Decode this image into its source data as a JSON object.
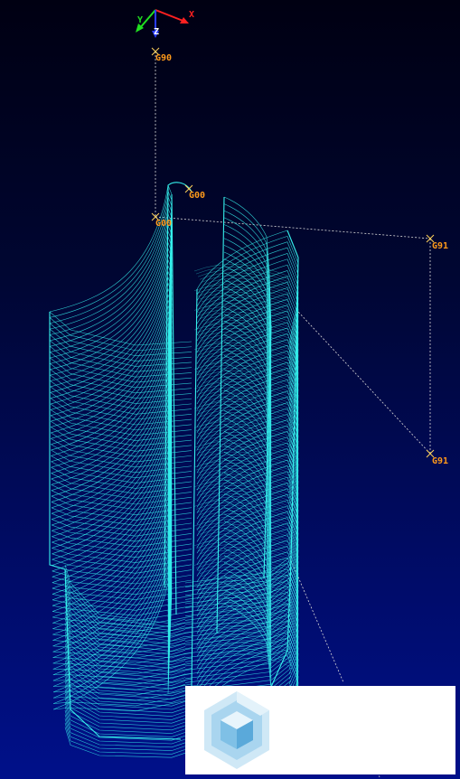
{
  "viewport": {
    "background_top": "#000012",
    "background_bottom": "#00108a",
    "toolpath_color": "#35f0ec",
    "rapid_path_color": "#d8d8d8",
    "point_marker_color": "#ffd25a",
    "label_color": "#ff9a1a"
  },
  "axes": {
    "x_label": "X",
    "y_label": "Y",
    "z_label": "Z",
    "x_color": "#ff2020",
    "y_color": "#20e020",
    "z_color": "#2a3cff"
  },
  "gcode_labels": {
    "top": "G90",
    "mid": "G00",
    "start": "G00",
    "right_upper": "G91",
    "right_lower": "G91"
  },
  "overlay": {
    "logo_icon": "cube-logo-icon",
    "logo_color": "#b8ddf2"
  }
}
